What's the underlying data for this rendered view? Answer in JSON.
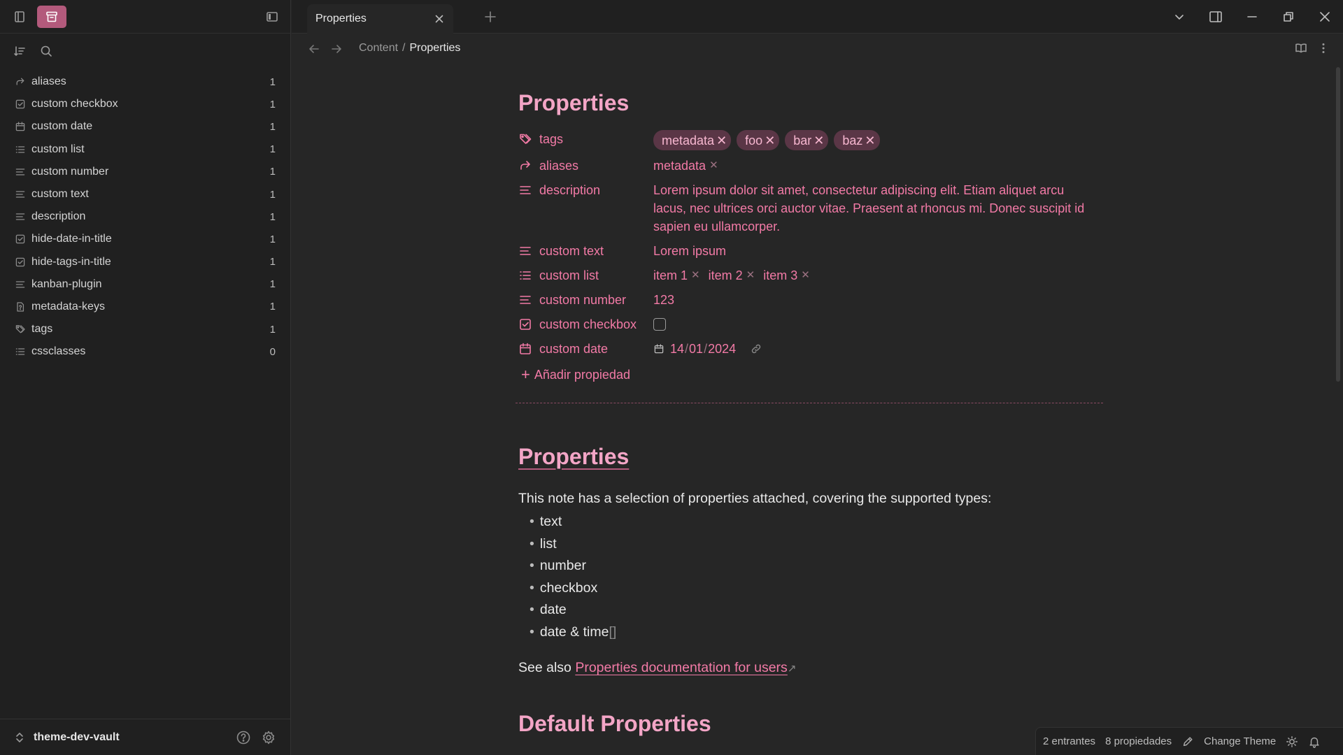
{
  "sidebar": {
    "vault_name": "theme-dev-vault",
    "items": [
      {
        "label": "aliases",
        "count": "1",
        "icon": "forward-arrow-icon"
      },
      {
        "label": "custom checkbox",
        "count": "1",
        "icon": "checkbox-icon"
      },
      {
        "label": "custom date",
        "count": "1",
        "icon": "calendar-icon"
      },
      {
        "label": "custom list",
        "count": "1",
        "icon": "list-icon"
      },
      {
        "label": "custom number",
        "count": "1",
        "icon": "text-icon"
      },
      {
        "label": "custom text",
        "count": "1",
        "icon": "text-icon"
      },
      {
        "label": "description",
        "count": "1",
        "icon": "text-icon"
      },
      {
        "label": "hide-date-in-title",
        "count": "1",
        "icon": "checkbox-icon"
      },
      {
        "label": "hide-tags-in-title",
        "count": "1",
        "icon": "checkbox-icon"
      },
      {
        "label": "kanban-plugin",
        "count": "1",
        "icon": "text-icon"
      },
      {
        "label": "metadata-keys",
        "count": "1",
        "icon": "file-question-icon"
      },
      {
        "label": "tags",
        "count": "1",
        "icon": "tags-icon"
      },
      {
        "label": "cssclasses",
        "count": "0",
        "icon": "list-icon"
      }
    ]
  },
  "tab": {
    "label": "Properties"
  },
  "breadcrumb": {
    "parent": "Content",
    "separator": "/",
    "current": "Properties"
  },
  "note": {
    "title": "Properties",
    "props": {
      "tags": {
        "key": "tags",
        "values": [
          "metadata",
          "foo",
          "bar",
          "baz"
        ]
      },
      "aliases": {
        "key": "aliases",
        "values": [
          "metadata"
        ]
      },
      "description": {
        "key": "description",
        "value": "Lorem ipsum dolor sit amet, consectetur adipiscing elit. Etiam aliquet arcu lacus, nec ultrices orci auctor vitae. Praesent at rhoncus mi. Donec suscipit id sapien eu ullamcorper."
      },
      "custom_text": {
        "key": "custom text",
        "value": "Lorem ipsum"
      },
      "custom_list": {
        "key": "custom list",
        "values": [
          "item 1",
          "item 2",
          "item 3"
        ]
      },
      "custom_number": {
        "key": "custom number",
        "value": "123"
      },
      "custom_checkbox": {
        "key": "custom checkbox",
        "checked": false
      },
      "custom_date": {
        "key": "custom date",
        "day": "14",
        "month": "01",
        "year": "2024"
      }
    },
    "add_property_label": "Añadir propiedad",
    "heading2": "Properties",
    "intro": "This note has a selection of properties attached, covering the supported types:",
    "types": [
      "text",
      "list",
      "number",
      "checkbox",
      "date",
      "date & time"
    ],
    "types_last_suffix": "[]",
    "see_also_prefix": "See also",
    "see_also_link": "Properties documentation for users",
    "heading3": "Default Properties"
  },
  "status": {
    "entries": "2 entrantes",
    "properties": "8 propiedades",
    "change_theme": "Change Theme"
  },
  "colors": {
    "accent": "#f27aa6",
    "accent_bg": "#b35a7c",
    "pill_bg": "#5a3646"
  }
}
